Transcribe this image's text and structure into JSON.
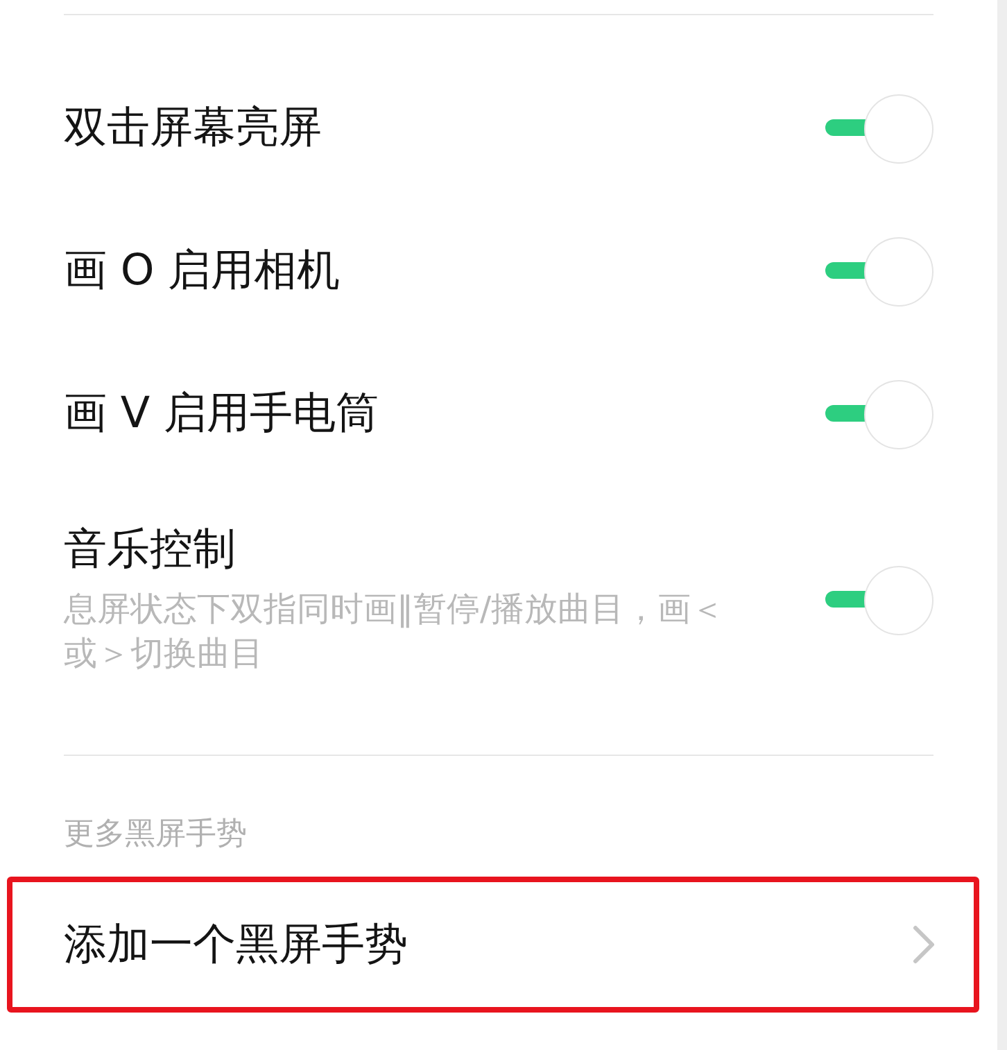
{
  "toggles": [
    {
      "title": "双击屏幕亮屏",
      "on": true
    },
    {
      "title": "画 O 启用相机",
      "on": true
    },
    {
      "title": "画 V 启用手电筒",
      "on": true
    },
    {
      "title": "音乐控制",
      "description": "息屏状态下双指同时画‖暂停/播放曲目，画＜或＞切换曲目",
      "on": true
    }
  ],
  "section": {
    "header": "更多黑屏手势",
    "items": [
      {
        "label": "添加一个黑屏手势",
        "highlighted": true
      }
    ]
  }
}
